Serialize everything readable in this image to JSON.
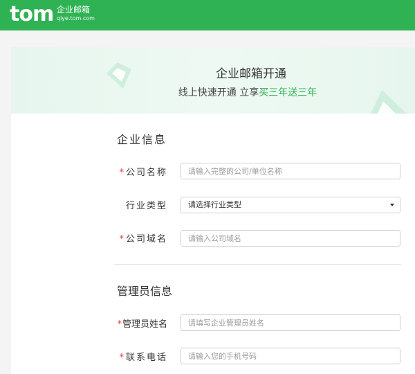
{
  "header": {
    "logo_text": "tom",
    "logo_cn": "企业邮箱",
    "logo_domain": "qiye.tom.com"
  },
  "banner": {
    "title": "企业邮箱开通",
    "subtitle_prefix": "线上快速开通 立享",
    "subtitle_highlight": "买三年送三年"
  },
  "company_section": {
    "title": "企业信息",
    "fields": {
      "company_name": {
        "required": "*",
        "label": "公司名称",
        "placeholder": "请输入完整的公司/单位名称"
      },
      "industry": {
        "label": "行业类型",
        "value": "请选择行业类型"
      },
      "domain": {
        "required": "*",
        "label": "公司域名",
        "placeholder": "请输入公司域名"
      }
    }
  },
  "admin_section": {
    "title": "管理员信息",
    "fields": {
      "admin_name": {
        "required": "*",
        "label": "管理员姓名",
        "placeholder": "请填写企业管理员姓名"
      },
      "phone": {
        "required": "*",
        "label": "联系电话",
        "placeholder": "请输入您的手机号码"
      }
    }
  },
  "colors": {
    "brand_green": "#2fb253",
    "required_red": "#e4393c"
  }
}
